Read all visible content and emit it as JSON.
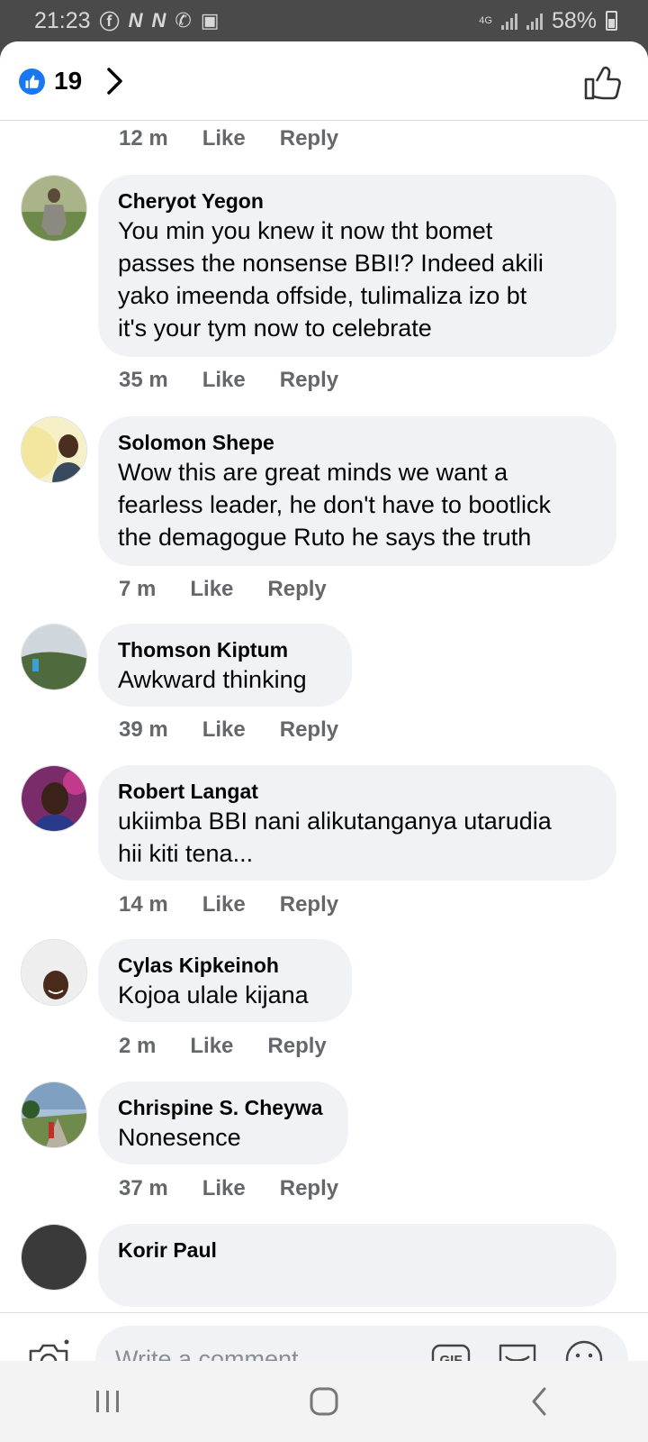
{
  "status_bar": {
    "time": "21:23",
    "network": "4G",
    "battery": "58%"
  },
  "header": {
    "like_count": "19"
  },
  "actions": {
    "like": "Like",
    "reply": "Reply"
  },
  "top_meta": {
    "time": "12 m"
  },
  "comments": [
    {
      "name": "Cheryot Yegon",
      "lines": [
        "You min you knew it now tht bomet",
        "passes the nonsense BBI!? Indeed akili",
        "yako imeenda offside, tulimaliza izo bt",
        "it's your tym now to celebrate"
      ],
      "time": "35 m"
    },
    {
      "name": "Solomon Shepe",
      "lines": [
        "Wow this are great minds we want a",
        "fearless leader, he don't have to bootlick",
        "the demagogue Ruto he says the truth"
      ],
      "time": "7 m"
    },
    {
      "name": "Thomson Kiptum",
      "lines": [
        "Awkward thinking"
      ],
      "time": "39 m"
    },
    {
      "name": "Robert Langat",
      "lines": [
        "ukiimba BBI nani alikutanganya utarudia",
        "hii kiti tena..."
      ],
      "time": "14 m"
    },
    {
      "name": "Cylas Kipkeinoh",
      "lines": [
        "Kojoa ulale kijana"
      ],
      "time": "2 m"
    },
    {
      "name": "Chrispine S. Cheywa",
      "lines": [
        "Nonesence"
      ],
      "time": "37 m"
    },
    {
      "name": "Korir Paul",
      "lines": [],
      "time": ""
    }
  ],
  "composer": {
    "placeholder": "Write a comment…",
    "gif_label": "GIF"
  },
  "colors": {
    "accent": "#1a77f2",
    "bubble": "#f0f2f5",
    "meta": "#65676b"
  }
}
